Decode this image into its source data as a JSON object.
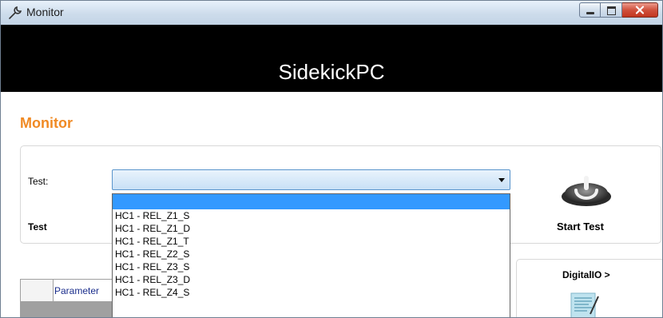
{
  "window": {
    "title": "Monitor"
  },
  "app": {
    "header": "SidekickPC"
  },
  "section": {
    "title": "Monitor"
  },
  "test_panel": {
    "test_label": "Test:",
    "test_label2": "Test",
    "combo_value": "",
    "start_test_label": "Start Test"
  },
  "dropdown": {
    "items": [
      "",
      "HC1 - REL_Z1_S",
      "HC1 - REL_Z1_D",
      "HC1 - REL_Z1_T",
      "HC1 - REL_Z2_S",
      "HC1 - REL_Z3_S",
      "HC1 - REL_Z3_D",
      "HC1 - REL_Z4_S"
    ]
  },
  "grid": {
    "column_parameter": "Parameter"
  },
  "digitalio": {
    "label": "DigitalIO >"
  },
  "colors": {
    "accent": "#f08a24",
    "header_bg": "#000000",
    "selection": "#3399ff"
  },
  "icons": {
    "window_icon": "wrench-icon",
    "start_test": "power-button-icon",
    "digitalio": "digital-io-icon"
  }
}
